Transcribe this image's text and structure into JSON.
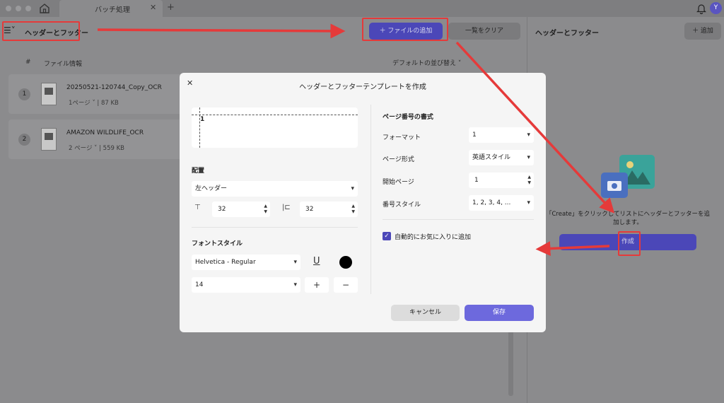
{
  "window": {
    "tab_title": "バッチ処理",
    "tab_close": "✕",
    "tab_add": "+",
    "avatar_initial": "Y"
  },
  "left": {
    "menu_icon": "☰˅",
    "title": "ヘッダーとフッター",
    "add_file_label": "＋ ファイルの追加",
    "clear_label": "一覧をクリア",
    "col_hash": "#",
    "col_file_info": "ファイル情報",
    "sort_label": "デフォルトの並び替え ˅",
    "files": [
      {
        "num": "1",
        "name": "20250521-120744_Copy_OCR",
        "meta": "1ページ ˅  |  87 KB"
      },
      {
        "num": "2",
        "name": "AMAZON WILDLIFE_OCR",
        "meta": "2 ページ ˅  |  559 KB"
      }
    ]
  },
  "right": {
    "title": "ヘッダーとフッター",
    "add_label": "＋ 追加",
    "empty_text": "「Create」をクリックしてリストにヘッダーとフッターを追加します。",
    "create_label": "作成"
  },
  "dialog": {
    "close": "✕",
    "title": "ヘッダーとフッターテンプレートを作成",
    "preview_number": "1",
    "placement_heading": "配置",
    "position_value": "左ヘッダー",
    "top_margin_icon": "⊤",
    "top_margin": "32",
    "side_margin_icon": "|⊏",
    "side_margin": "32",
    "font_heading": "フォントスタイル",
    "font_family": "Helvetica - Regular",
    "underline_icon": "U",
    "font_size": "14",
    "plus": "+",
    "minus": "−",
    "page_format_heading": "ページ番号の書式",
    "format_label": "フォーマット",
    "format_value": "1",
    "page_type_label": "ページ形式",
    "page_type_value": "英語スタイル",
    "start_page_label": "開始ページ",
    "start_page_value": "1",
    "number_style_label": "番号スタイル",
    "number_style_value": "1, 2, 3, 4, ...",
    "auto_favorite": "自動的にお気に入りに追加",
    "cancel": "キャンセル",
    "save": "保存"
  },
  "colors": {
    "accent": "#4b47b8",
    "annotation_red": "#e53a3a",
    "overlay": "#8b8b8d"
  }
}
